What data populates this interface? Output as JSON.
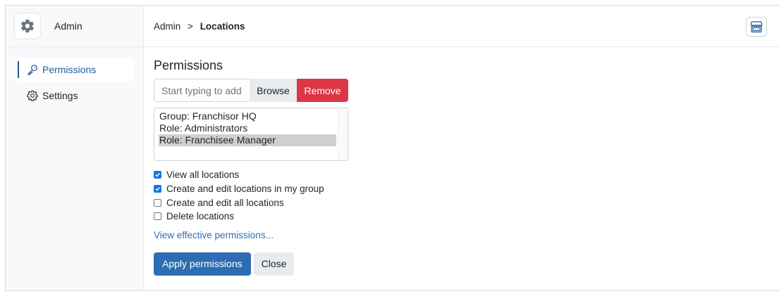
{
  "sidebar": {
    "brand": {
      "title": "Admin",
      "icon": "gear-icon"
    },
    "items": [
      {
        "label": "Permissions",
        "icon": "key-icon",
        "active": true
      },
      {
        "label": "Settings",
        "icon": "gear-icon",
        "active": false
      }
    ]
  },
  "header": {
    "breadcrumb": {
      "root": "Admin",
      "separator": ">",
      "current": "Locations"
    },
    "store_button_icon": "store-icon"
  },
  "permissions": {
    "title": "Permissions",
    "search": {
      "placeholder": "Start typing to add",
      "value": ""
    },
    "browse_label": "Browse",
    "remove_label": "Remove",
    "principals": [
      {
        "label": "Group: Franchisor HQ",
        "selected": false
      },
      {
        "label": "Role: Administrators",
        "selected": false
      },
      {
        "label": "Role: Franchisee Manager",
        "selected": true
      }
    ],
    "checkboxes": [
      {
        "label": "View all locations",
        "checked": true
      },
      {
        "label": "Create and edit locations in my group",
        "checked": true
      },
      {
        "label": "Create and edit all locations",
        "checked": false
      },
      {
        "label": "Delete locations",
        "checked": false
      }
    ],
    "effective_link": "View effective permissions...",
    "apply_label": "Apply permissions",
    "close_label": "Close"
  },
  "colors": {
    "accent": "#2c6db3",
    "danger": "#dc3545",
    "selected_option": "#cfcfcf"
  }
}
